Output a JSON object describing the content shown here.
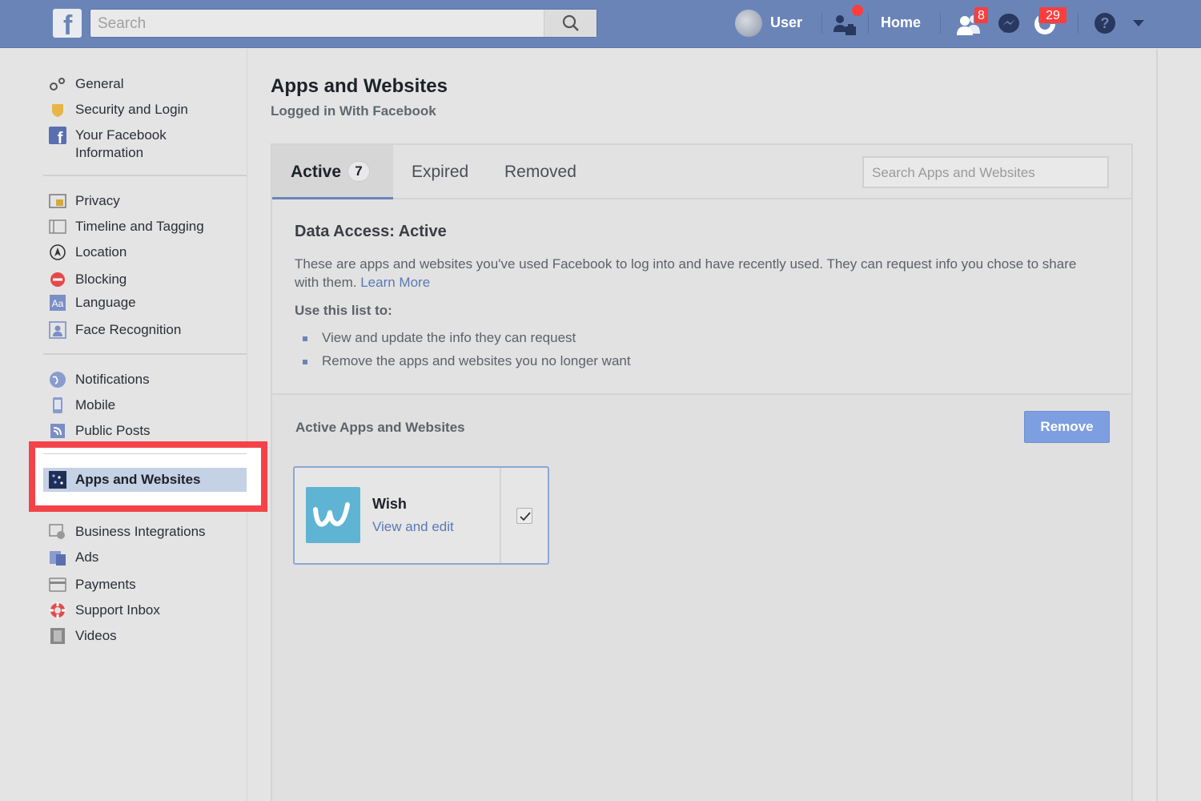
{
  "topbar": {
    "search_placeholder": "Search",
    "user_label": "User",
    "home_label": "Home",
    "friend_requests_badge": "8",
    "notifications_badge": "29",
    "icons": [
      "facebook-logo",
      "search-icon",
      "find-friends-icon",
      "friend-requests-icon",
      "messenger-icon",
      "notifications-icon",
      "help-icon",
      "caret-down-icon"
    ]
  },
  "sidebar": {
    "group1": [
      {
        "label": "General",
        "icon": "gear-icon"
      },
      {
        "label": "Security and Login",
        "icon": "shield-icon"
      },
      {
        "label": "Your Facebook Information",
        "icon": "facebook-icon"
      }
    ],
    "group2": [
      {
        "label": "Privacy",
        "icon": "lock-icon"
      },
      {
        "label": "Timeline and Tagging",
        "icon": "timeline-icon"
      },
      {
        "label": "Location",
        "icon": "location-icon"
      },
      {
        "label": "Blocking",
        "icon": "block-icon"
      },
      {
        "label": "Language",
        "icon": "language-icon"
      },
      {
        "label": "Face Recognition",
        "icon": "face-recognition-icon"
      }
    ],
    "group3": [
      {
        "label": "Notifications",
        "icon": "globe-icon"
      },
      {
        "label": "Mobile",
        "icon": "mobile-icon"
      },
      {
        "label": "Public Posts",
        "icon": "rss-icon"
      }
    ],
    "active_item": {
      "label": "Apps and Websites",
      "icon": "apps-icon"
    },
    "group4": [
      {
        "label": "Business Integrations",
        "icon": "business-icon"
      },
      {
        "label": "Ads",
        "icon": "ads-icon"
      },
      {
        "label": "Payments",
        "icon": "card-icon"
      },
      {
        "label": "Support Inbox",
        "icon": "lifebuoy-icon"
      },
      {
        "label": "Videos",
        "icon": "film-icon"
      }
    ]
  },
  "main": {
    "title": "Apps and Websites",
    "subtitle": "Logged in With Facebook",
    "tabs": [
      {
        "label": "Active",
        "count": "7"
      },
      {
        "label": "Expired"
      },
      {
        "label": "Removed"
      }
    ],
    "search_placeholder": "Search Apps and Websites",
    "info_title": "Data Access: Active",
    "info_text": "These are apps and websites you've used Facebook to log into and have recently used. They can request info you chose to share with them.",
    "learn_more": "Learn More",
    "use_list_label": "Use this list to:",
    "bullets": [
      "View and update the info they can request",
      "Remove the apps and websites you no longer want"
    ],
    "active_section_label": "Active Apps and Websites",
    "remove_button": "Remove",
    "apps": [
      {
        "name": "Wish",
        "action": "View and edit",
        "checked": true
      }
    ]
  },
  "colors": {
    "topbar": "#6b84b8",
    "highlight": "#f44348",
    "link": "#5a79b5",
    "button": "#7d9ee0"
  }
}
